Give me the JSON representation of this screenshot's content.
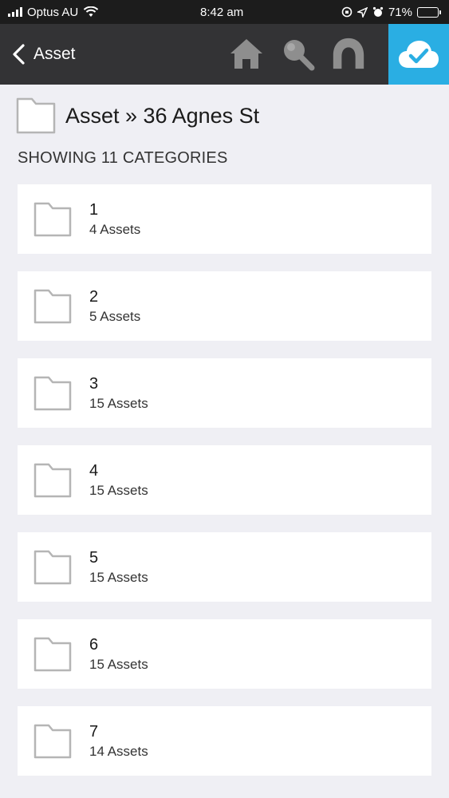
{
  "status_bar": {
    "carrier": "Optus AU",
    "time": "8:42 am",
    "battery_percent": "71%",
    "battery_level": 0.71
  },
  "nav": {
    "back_label": "Asset",
    "accent_color": "#2aaee3",
    "icons": [
      "home-icon",
      "search-icon",
      "profile-icon",
      "cloud-check-icon"
    ]
  },
  "breadcrumb": {
    "text": "Asset » 36 Agnes St"
  },
  "showing_label": "SHOWING 11 CATEGORIES",
  "categories": [
    {
      "name": "1",
      "count": "4 Assets"
    },
    {
      "name": "2",
      "count": "5 Assets"
    },
    {
      "name": "3",
      "count": "15 Assets"
    },
    {
      "name": "4",
      "count": "15 Assets"
    },
    {
      "name": "5",
      "count": "15 Assets"
    },
    {
      "name": "6",
      "count": "15 Assets"
    },
    {
      "name": "7",
      "count": "14 Assets"
    }
  ]
}
